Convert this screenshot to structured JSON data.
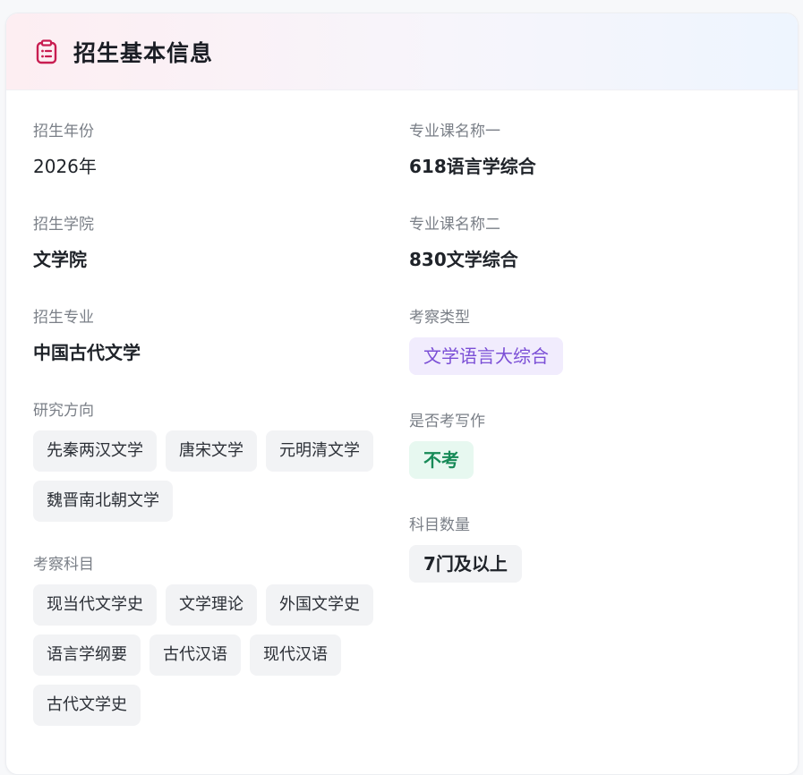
{
  "header": {
    "title": "招生基本信息",
    "icon": "clipboard-icon",
    "icon_color": "#c81d51"
  },
  "left": {
    "year": {
      "label": "招生年份",
      "value": "2026年"
    },
    "college": {
      "label": "招生学院",
      "value": "文学院"
    },
    "major": {
      "label": "招生专业",
      "value": "中国古代文学"
    },
    "directions": {
      "label": "研究方向",
      "tags": [
        "先秦两汉文学",
        "唐宋文学",
        "元明清文学",
        "魏晋南北朝文学"
      ]
    },
    "subjects": {
      "label": "考察科目",
      "tags": [
        "现当代文学史",
        "文学理论",
        "外国文学史",
        "语言学纲要",
        "古代汉语",
        "现代汉语",
        "古代文学史"
      ]
    }
  },
  "right": {
    "course1": {
      "label": "专业课名称一",
      "value": "618语言学综合"
    },
    "course2": {
      "label": "专业课名称二",
      "value": "830文学综合"
    },
    "exam_type": {
      "label": "考察类型",
      "value": "文学语言大综合",
      "color": "#7b4fd6"
    },
    "writing": {
      "label": "是否考写作",
      "value": "不考",
      "color": "#168a57"
    },
    "subject_count": {
      "label": "科目数量",
      "value": "7门及以上"
    }
  }
}
